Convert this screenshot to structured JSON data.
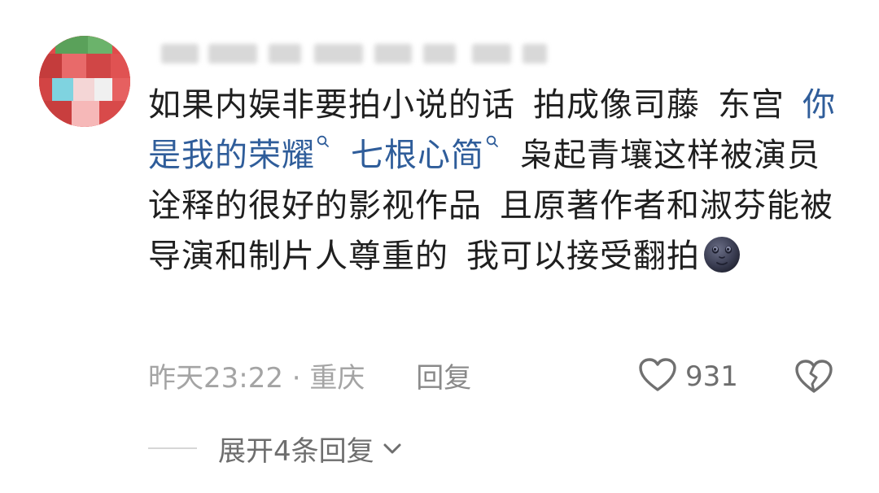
{
  "comment": {
    "line1": "如果内娱非要拍小说的话",
    "line1b": "拍成像司藤",
    "line1c": "东宫",
    "link1": "你是我的荣耀",
    "link2": "七根心简",
    "text_after": "枭起青壤这样被演员诠释的很好的影视作品",
    "text_after2": "且原著作者和淑芬能被导演和制片人尊重的",
    "text_after3": "我可以接受翻拍",
    "emoji": "new-moon-face-icon"
  },
  "meta": {
    "time": "昨天23:22",
    "separator": "·",
    "location": "重庆",
    "reply_label": "回复"
  },
  "actions": {
    "like_count": "931",
    "like_icon": "heart-outline-icon",
    "dislike_icon": "broken-heart-icon"
  },
  "expand": {
    "label": "展开4条回复"
  },
  "colors": {
    "link": "#2f5d9a",
    "meta": "#a4a4a4",
    "text": "#1f1f1f"
  }
}
